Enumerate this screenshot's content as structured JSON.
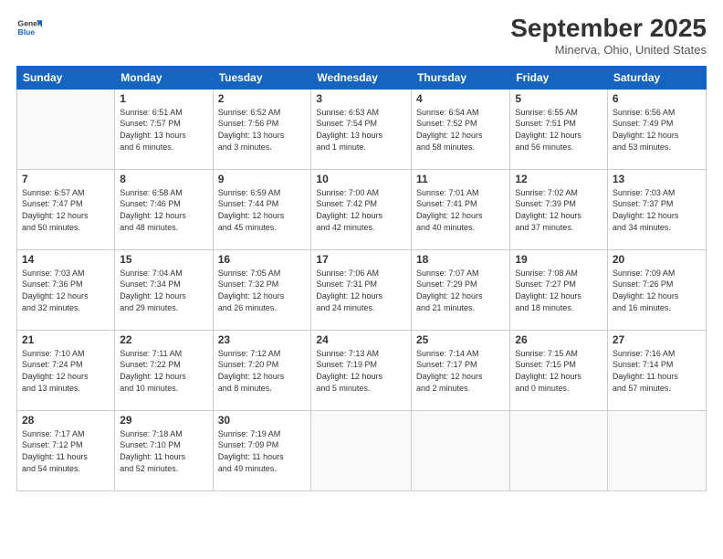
{
  "header": {
    "logo": {
      "line1": "General",
      "line2": "Blue"
    },
    "title": "September 2025",
    "subtitle": "Minerva, Ohio, United States"
  },
  "days_of_week": [
    "Sunday",
    "Monday",
    "Tuesday",
    "Wednesday",
    "Thursday",
    "Friday",
    "Saturday"
  ],
  "weeks": [
    [
      {
        "day": "",
        "info": ""
      },
      {
        "day": "1",
        "info": "Sunrise: 6:51 AM\nSunset: 7:57 PM\nDaylight: 13 hours\nand 6 minutes."
      },
      {
        "day": "2",
        "info": "Sunrise: 6:52 AM\nSunset: 7:56 PM\nDaylight: 13 hours\nand 3 minutes."
      },
      {
        "day": "3",
        "info": "Sunrise: 6:53 AM\nSunset: 7:54 PM\nDaylight: 13 hours\nand 1 minute."
      },
      {
        "day": "4",
        "info": "Sunrise: 6:54 AM\nSunset: 7:52 PM\nDaylight: 12 hours\nand 58 minutes."
      },
      {
        "day": "5",
        "info": "Sunrise: 6:55 AM\nSunset: 7:51 PM\nDaylight: 12 hours\nand 56 minutes."
      },
      {
        "day": "6",
        "info": "Sunrise: 6:56 AM\nSunset: 7:49 PM\nDaylight: 12 hours\nand 53 minutes."
      }
    ],
    [
      {
        "day": "7",
        "info": "Sunrise: 6:57 AM\nSunset: 7:47 PM\nDaylight: 12 hours\nand 50 minutes."
      },
      {
        "day": "8",
        "info": "Sunrise: 6:58 AM\nSunset: 7:46 PM\nDaylight: 12 hours\nand 48 minutes."
      },
      {
        "day": "9",
        "info": "Sunrise: 6:59 AM\nSunset: 7:44 PM\nDaylight: 12 hours\nand 45 minutes."
      },
      {
        "day": "10",
        "info": "Sunrise: 7:00 AM\nSunset: 7:42 PM\nDaylight: 12 hours\nand 42 minutes."
      },
      {
        "day": "11",
        "info": "Sunrise: 7:01 AM\nSunset: 7:41 PM\nDaylight: 12 hours\nand 40 minutes."
      },
      {
        "day": "12",
        "info": "Sunrise: 7:02 AM\nSunset: 7:39 PM\nDaylight: 12 hours\nand 37 minutes."
      },
      {
        "day": "13",
        "info": "Sunrise: 7:03 AM\nSunset: 7:37 PM\nDaylight: 12 hours\nand 34 minutes."
      }
    ],
    [
      {
        "day": "14",
        "info": "Sunrise: 7:03 AM\nSunset: 7:36 PM\nDaylight: 12 hours\nand 32 minutes."
      },
      {
        "day": "15",
        "info": "Sunrise: 7:04 AM\nSunset: 7:34 PM\nDaylight: 12 hours\nand 29 minutes."
      },
      {
        "day": "16",
        "info": "Sunrise: 7:05 AM\nSunset: 7:32 PM\nDaylight: 12 hours\nand 26 minutes."
      },
      {
        "day": "17",
        "info": "Sunrise: 7:06 AM\nSunset: 7:31 PM\nDaylight: 12 hours\nand 24 minutes."
      },
      {
        "day": "18",
        "info": "Sunrise: 7:07 AM\nSunset: 7:29 PM\nDaylight: 12 hours\nand 21 minutes."
      },
      {
        "day": "19",
        "info": "Sunrise: 7:08 AM\nSunset: 7:27 PM\nDaylight: 12 hours\nand 18 minutes."
      },
      {
        "day": "20",
        "info": "Sunrise: 7:09 AM\nSunset: 7:26 PM\nDaylight: 12 hours\nand 16 minutes."
      }
    ],
    [
      {
        "day": "21",
        "info": "Sunrise: 7:10 AM\nSunset: 7:24 PM\nDaylight: 12 hours\nand 13 minutes."
      },
      {
        "day": "22",
        "info": "Sunrise: 7:11 AM\nSunset: 7:22 PM\nDaylight: 12 hours\nand 10 minutes."
      },
      {
        "day": "23",
        "info": "Sunrise: 7:12 AM\nSunset: 7:20 PM\nDaylight: 12 hours\nand 8 minutes."
      },
      {
        "day": "24",
        "info": "Sunrise: 7:13 AM\nSunset: 7:19 PM\nDaylight: 12 hours\nand 5 minutes."
      },
      {
        "day": "25",
        "info": "Sunrise: 7:14 AM\nSunset: 7:17 PM\nDaylight: 12 hours\nand 2 minutes."
      },
      {
        "day": "26",
        "info": "Sunrise: 7:15 AM\nSunset: 7:15 PM\nDaylight: 12 hours\nand 0 minutes."
      },
      {
        "day": "27",
        "info": "Sunrise: 7:16 AM\nSunset: 7:14 PM\nDaylight: 11 hours\nand 57 minutes."
      }
    ],
    [
      {
        "day": "28",
        "info": "Sunrise: 7:17 AM\nSunset: 7:12 PM\nDaylight: 11 hours\nand 54 minutes."
      },
      {
        "day": "29",
        "info": "Sunrise: 7:18 AM\nSunset: 7:10 PM\nDaylight: 11 hours\nand 52 minutes."
      },
      {
        "day": "30",
        "info": "Sunrise: 7:19 AM\nSunset: 7:09 PM\nDaylight: 11 hours\nand 49 minutes."
      },
      {
        "day": "",
        "info": ""
      },
      {
        "day": "",
        "info": ""
      },
      {
        "day": "",
        "info": ""
      },
      {
        "day": "",
        "info": ""
      }
    ]
  ]
}
